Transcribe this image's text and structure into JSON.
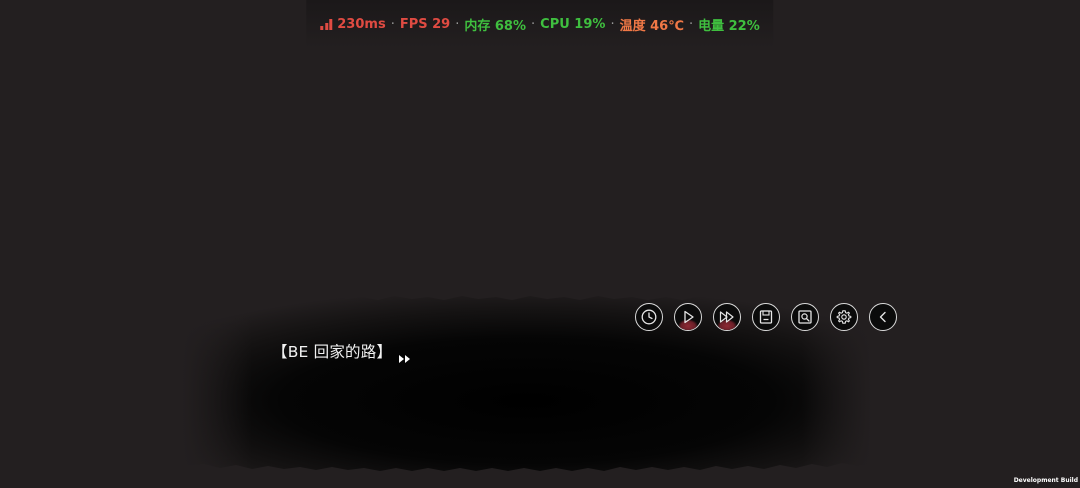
{
  "perf": {
    "latency": "230ms",
    "fps": "FPS 29",
    "memory": "内存 68%",
    "cpu": "CPU 19%",
    "temperature": "温度 46℃",
    "battery": "电量 22%",
    "separator": "·",
    "colors": {
      "latency": "#e04b42",
      "fps": "#e04b42",
      "memory": "#3fbf3f",
      "cpu": "#3fbf3f",
      "temperature": "#f07846",
      "battery": "#3fbf3f"
    }
  },
  "dialogue": {
    "text": "【BE 回家的路】"
  },
  "controls": {
    "buttons": [
      {
        "name": "history",
        "icon": "clock-icon"
      },
      {
        "name": "auto-play",
        "icon": "play-icon"
      },
      {
        "name": "skip",
        "icon": "fast-forward-icon"
      },
      {
        "name": "save",
        "icon": "save-icon"
      },
      {
        "name": "load",
        "icon": "load-search-icon"
      },
      {
        "name": "settings",
        "icon": "gear-icon"
      },
      {
        "name": "back",
        "icon": "chevron-left-icon"
      }
    ]
  },
  "footer": {
    "build_label": "Development Build"
  },
  "theme": {
    "background": "#231f20",
    "dialog_bg": "#000000",
    "accent": "#8e2a34"
  }
}
